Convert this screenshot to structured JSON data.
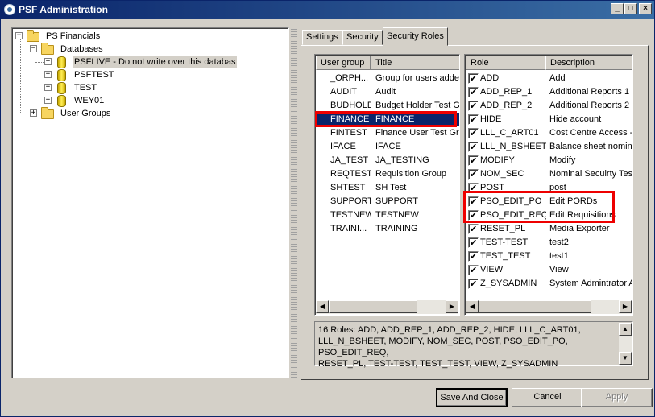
{
  "window": {
    "title": "PSF Administration",
    "minimize": "_",
    "maximize": "□",
    "close": "×"
  },
  "tree": {
    "root": "PS Financials",
    "databases_label": "Databases",
    "databases": [
      "PSFLIVE - Do not write over this databas",
      "PSFTEST",
      "TEST",
      "WEY01"
    ],
    "user_groups_label": "User Groups"
  },
  "tabs": [
    "Settings",
    "Security",
    "Security Roles"
  ],
  "groups": {
    "headers": {
      "user_group": "User group",
      "title": "Title"
    },
    "rows": [
      {
        "group": "_ORPH...",
        "title": "Group for users adde"
      },
      {
        "group": "AUDIT",
        "title": "Audit"
      },
      {
        "group": "BUDHOLD",
        "title": "Budget Holder Test G"
      },
      {
        "group": "FINANCE",
        "title": "FINANCE"
      },
      {
        "group": "FINTEST",
        "title": "Finance User Test Gr"
      },
      {
        "group": "IFACE",
        "title": "IFACE"
      },
      {
        "group": "JA_TEST",
        "title": "JA_TESTING"
      },
      {
        "group": "REQTEST",
        "title": "Requisition Group"
      },
      {
        "group": "SHTEST",
        "title": "SH Test"
      },
      {
        "group": "SUPPORT",
        "title": "SUPPORT"
      },
      {
        "group": "TESTNEW",
        "title": "TESTNEW"
      },
      {
        "group": "TRAINI...",
        "title": "TRAINING"
      }
    ]
  },
  "roles": {
    "headers": {
      "role": "Role",
      "description": "Description"
    },
    "rows": [
      {
        "role": "ADD",
        "description": "Add"
      },
      {
        "role": "ADD_REP_1",
        "description": "Additional Reports 1"
      },
      {
        "role": "ADD_REP_2",
        "description": "Additional Reports 2"
      },
      {
        "role": "HIDE",
        "description": "Hide account"
      },
      {
        "role": "LLL_C_ART01",
        "description": "Cost Centre Access -"
      },
      {
        "role": "LLL_N_BSHEET",
        "description": "Balance sheet nomina"
      },
      {
        "role": "MODIFY",
        "description": "Modify"
      },
      {
        "role": "NOM_SEC",
        "description": "Nominal Secuirty Test"
      },
      {
        "role": "POST",
        "description": "post"
      },
      {
        "role": "PSO_EDIT_PO",
        "description": "Edit PORDs"
      },
      {
        "role": "PSO_EDIT_REQ",
        "description": "Edit Requisitions"
      },
      {
        "role": "RESET_PL",
        "description": "Media Exporter"
      },
      {
        "role": "TEST-TEST",
        "description": "test2"
      },
      {
        "role": "TEST_TEST",
        "description": "test1"
      },
      {
        "role": "VIEW",
        "description": "View"
      },
      {
        "role": "Z_SYSADMIN",
        "description": "System Admintrator A"
      }
    ]
  },
  "summary": {
    "line1": "16 Roles: ADD, ADD_REP_1, ADD_REP_2, HIDE, LLL_C_ART01,",
    "line2": "LLL_N_BSHEET, MODIFY, NOM_SEC, POST, PSO_EDIT_PO, PSO_EDIT_REQ,",
    "line3": "RESET_PL, TEST-TEST, TEST_TEST, VIEW, Z_SYSADMIN"
  },
  "buttons": {
    "save_close": "Save And Close",
    "cancel": "Cancel",
    "apply": "Apply"
  },
  "colors": {
    "selection": "#0a246a",
    "highlight": "#e00000",
    "face": "#d4d0c8"
  }
}
